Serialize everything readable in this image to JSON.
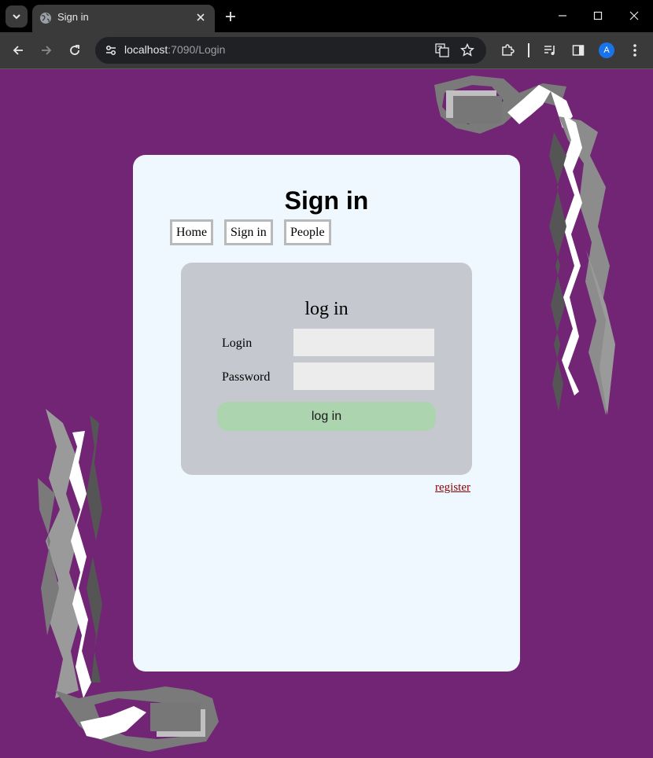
{
  "browser": {
    "tab_title": "Sign in",
    "url_host": "localhost",
    "url_path": ":7090/Login",
    "profile_initial": "A"
  },
  "page": {
    "title": "Sign in",
    "nav": {
      "home": "Home",
      "sign_in": "Sign in",
      "people": "People"
    },
    "login_form": {
      "heading": "log in",
      "login_label": "Login",
      "login_value": "",
      "password_label": "Password",
      "password_value": "",
      "submit_label": "log in"
    },
    "register_link": "register"
  },
  "colors": {
    "background": "#712574",
    "card": "#f0f8ff",
    "panel": "#c5c8cf",
    "submit": "#abd4af",
    "link": "#8b0000"
  }
}
